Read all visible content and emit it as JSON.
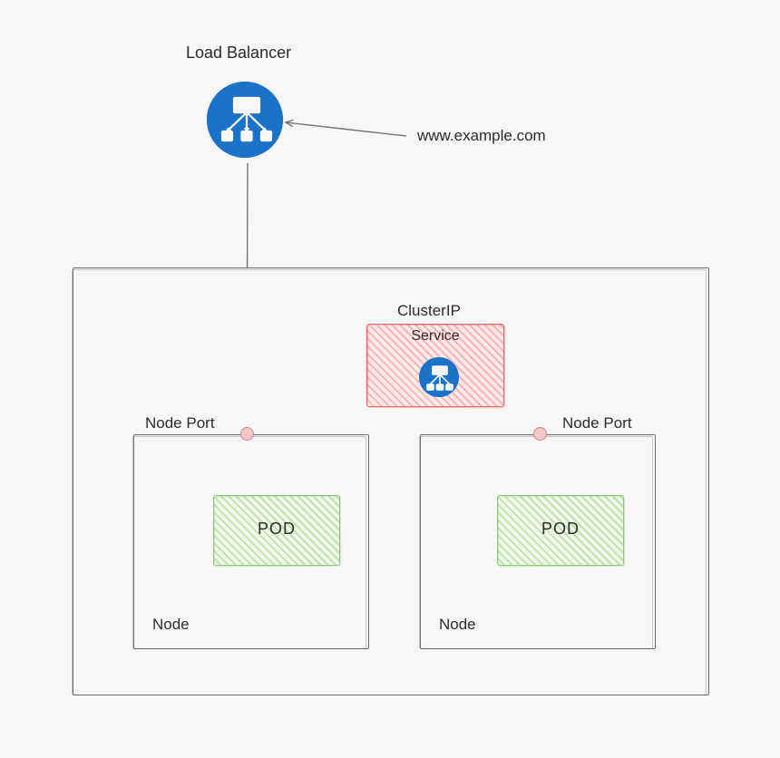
{
  "colors": {
    "bg": "#f7f7f7",
    "stroke": "#6b6b6b",
    "blue": "#1a73c9",
    "red_fill": "#f7b5b5",
    "red_stroke": "#e06a6a",
    "green_fill": "#bfe2a8",
    "green_stroke": "#8dc97a",
    "port_fill": "#f5c6c6",
    "port_stroke": "#c98a8a"
  },
  "load_balancer": {
    "title": "Load Balancer",
    "ingress_label": "www.example.com"
  },
  "clusterip": {
    "title": "ClusterIP",
    "subtitle": "Service"
  },
  "nodes": {
    "left": {
      "port_label": "Node Port",
      "name": "Node",
      "pod": "POD"
    },
    "right": {
      "port_label": "Node Port",
      "name": "Node",
      "pod": "POD"
    }
  }
}
